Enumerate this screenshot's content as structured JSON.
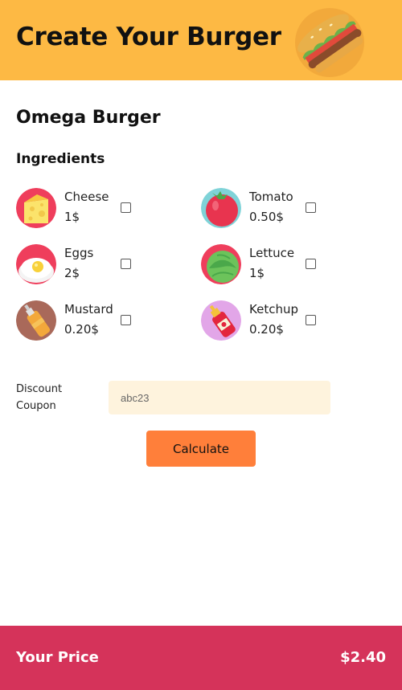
{
  "header": {
    "title": "Create Your Burger",
    "logo_icon": "burger-icon"
  },
  "product": {
    "name": "Omega Burger"
  },
  "ingredients_section": {
    "title": "Ingredients",
    "items": [
      {
        "name": "Cheese",
        "price": "1$",
        "icon": "cheese-icon",
        "checked": false
      },
      {
        "name": "Tomato",
        "price": "0.50$",
        "icon": "tomato-icon",
        "checked": false
      },
      {
        "name": "Eggs",
        "price": "2$",
        "icon": "egg-icon",
        "checked": false
      },
      {
        "name": "Lettuce",
        "price": "1$",
        "icon": "lettuce-icon",
        "checked": false
      },
      {
        "name": "Mustard",
        "price": "0.20$",
        "icon": "mustard-icon",
        "checked": false
      },
      {
        "name": "Ketchup",
        "price": "0.20$",
        "icon": "ketchup-icon",
        "checked": false
      }
    ]
  },
  "coupon": {
    "label": "Discount Coupon",
    "placeholder": "abc23",
    "value": ""
  },
  "actions": {
    "calculate_label": "Calculate"
  },
  "footer": {
    "label": "Your Price",
    "price": "$2.40"
  },
  "colors": {
    "header_bg": "#fdb944",
    "footer_bg": "#d5335a",
    "button_bg": "#ff7f3a",
    "input_bg": "#fef3dd"
  }
}
